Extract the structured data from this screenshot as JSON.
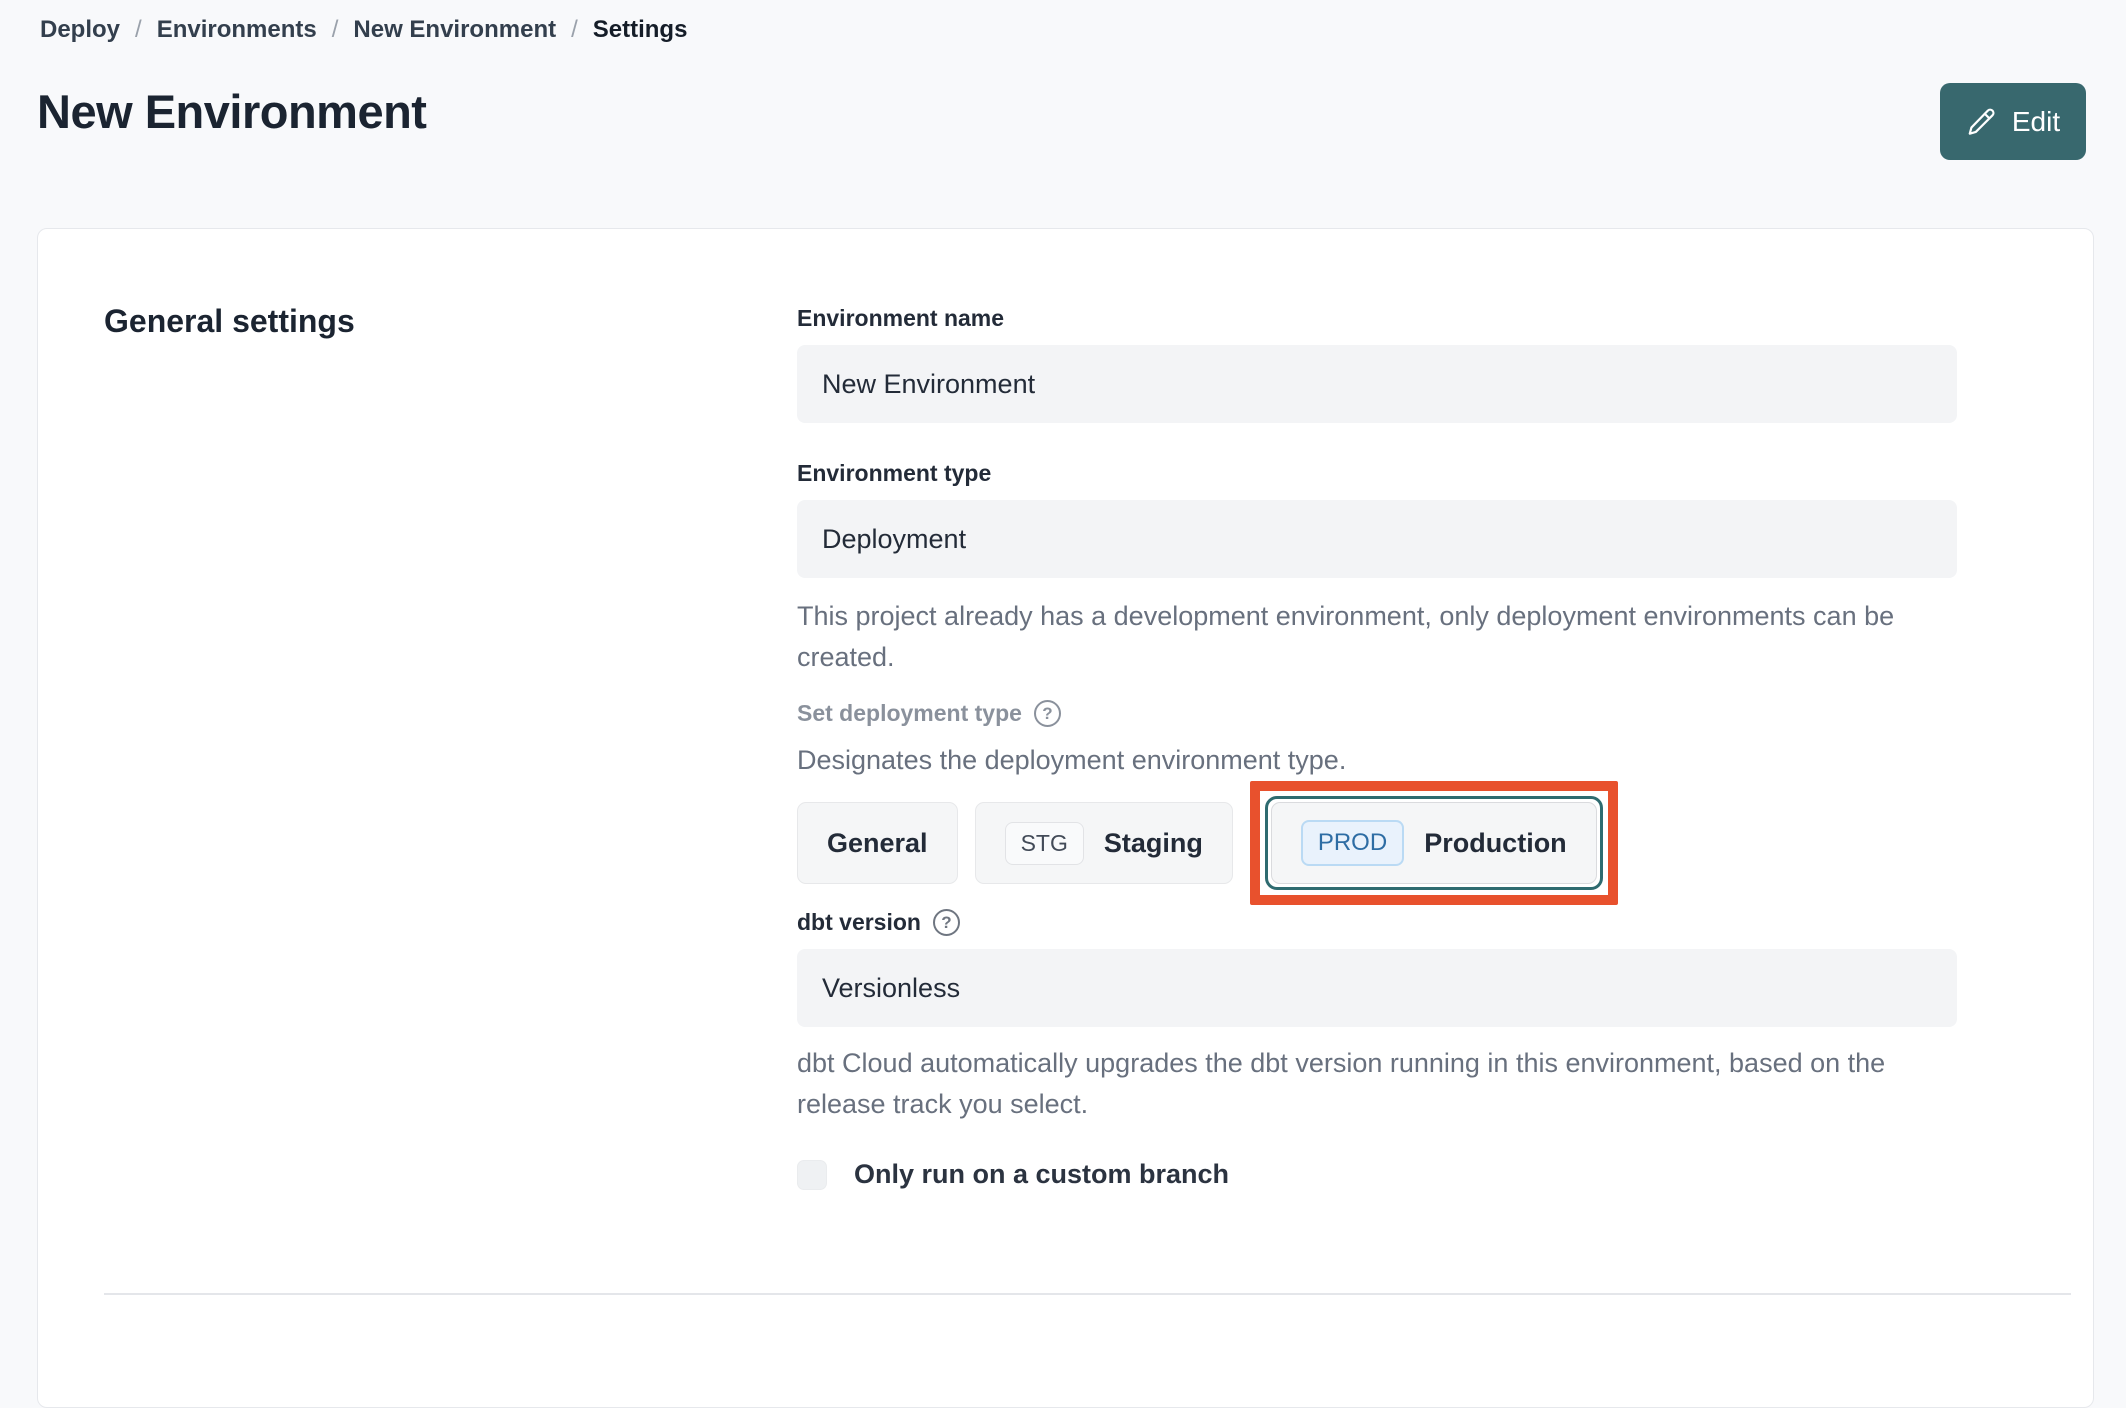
{
  "breadcrumb": {
    "separator": "/",
    "items": [
      "Deploy",
      "Environments",
      "New Environment"
    ],
    "current": "Settings"
  },
  "header": {
    "title": "New Environment",
    "edit_button": "Edit"
  },
  "icons": {
    "help": "?",
    "edit_pencil": "pencil-icon"
  },
  "colors": {
    "accent_teal": "#38686e",
    "selected_ring_teal": "#2e6b70",
    "annotation_orange": "#e8512d",
    "prod_badge_text": "#2e6da4",
    "prod_badge_bg": "#e9f2fc",
    "prod_badge_border": "#badaf4",
    "input_bg": "#f3f4f6",
    "page_bg": "#f8f9fb"
  },
  "card": {
    "section_title": "General settings",
    "environment_name": {
      "label": "Environment name",
      "value": "New Environment"
    },
    "environment_type": {
      "label": "Environment type",
      "value": "Deployment",
      "helper": "This project already has a development environment, only deployment environments can be created."
    },
    "deployment_type": {
      "label": "Set deployment type",
      "helper": "Designates the deployment environment type.",
      "options": [
        {
          "label": "General",
          "badge": "",
          "selected": false
        },
        {
          "label": "Staging",
          "badge": "STG",
          "selected": false
        },
        {
          "label": "Production",
          "badge": "PROD",
          "selected": true
        }
      ]
    },
    "dbt_version": {
      "label": "dbt version",
      "value": "Versionless",
      "helper": "dbt Cloud automatically upgrades the dbt version running in this environment, based on the release track you select."
    },
    "custom_branch": {
      "label": "Only run on a custom branch",
      "checked": false
    }
  }
}
